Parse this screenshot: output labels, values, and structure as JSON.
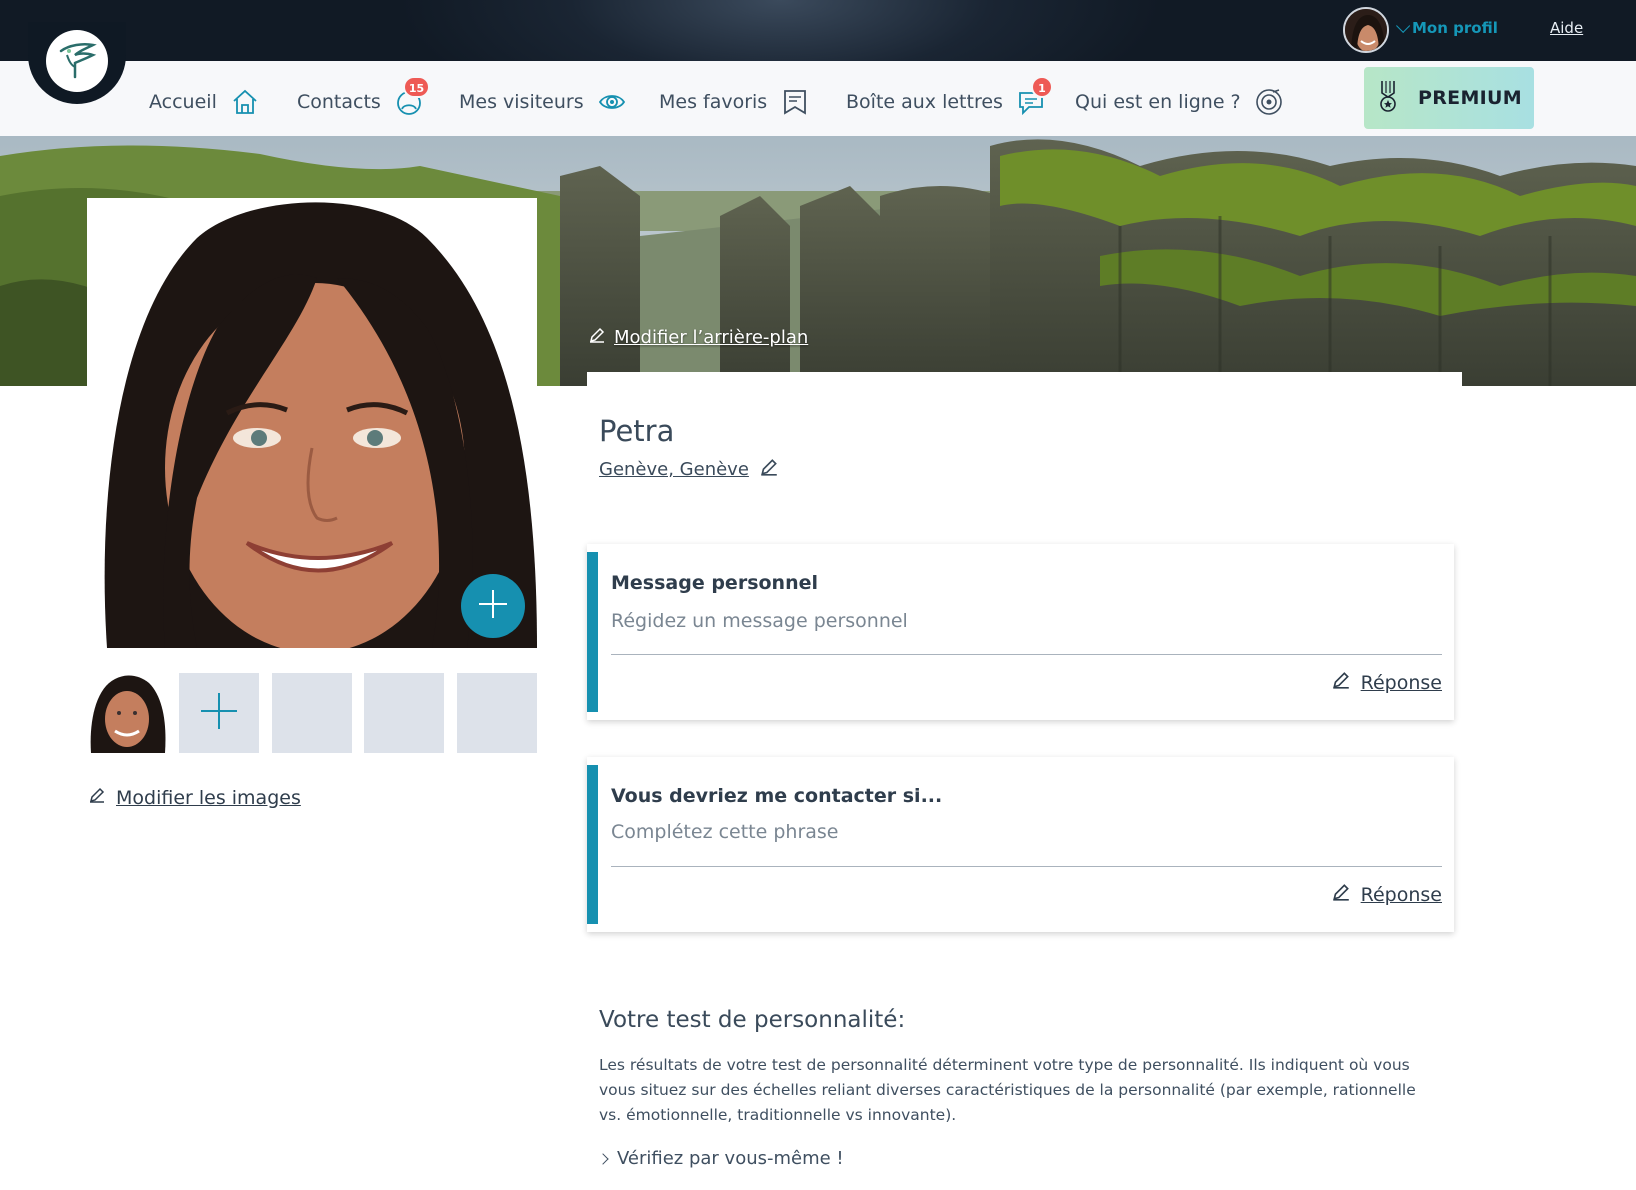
{
  "header": {
    "profile_label": "Mon profil",
    "help_label": "Aide"
  },
  "nav": {
    "items": [
      {
        "label": "Accueil",
        "icon": "home-icon"
      },
      {
        "label": "Contacts",
        "icon": "contacts-icon",
        "badge": "15"
      },
      {
        "label": "Mes visiteurs",
        "icon": "eye-icon"
      },
      {
        "label": "Mes favoris",
        "icon": "bookmark-icon"
      },
      {
        "label": "Boîte aux lettres",
        "icon": "mail-chat-icon",
        "badge": "1"
      },
      {
        "label": "Qui est en ligne ?",
        "icon": "online-target-icon"
      }
    ],
    "premium_label": "PREMIUM"
  },
  "hero": {
    "edit_background_label": "Modifier l’arrière-plan"
  },
  "photos": {
    "edit_images_label": "Modifier les images"
  },
  "profile": {
    "name": "Petra",
    "location": "Genève, Genève"
  },
  "questions": [
    {
      "title": "Message personnel",
      "placeholder": "Régidez un message personnel",
      "reply_label": "Réponse"
    },
    {
      "title": "Vous devriez me contacter si...",
      "placeholder": "Complétez cette phrase",
      "reply_label": "Réponse"
    }
  ],
  "personality": {
    "title": "Votre test de personnalité:",
    "text": "Les résultats de votre test de personnalité déterminent votre type de personnalité. Ils indiquent où vous vous situez sur des échelles reliant diverses caractéristiques de la personnalité (par exemple, rationnelle vs. émotionnelle, traditionnelle vs innovante).",
    "verify_label": "Vérifiez par vous-même !"
  },
  "colors": {
    "accent": "#1690b0",
    "badge": "#ee5a55",
    "topbar": "#1a2533"
  }
}
